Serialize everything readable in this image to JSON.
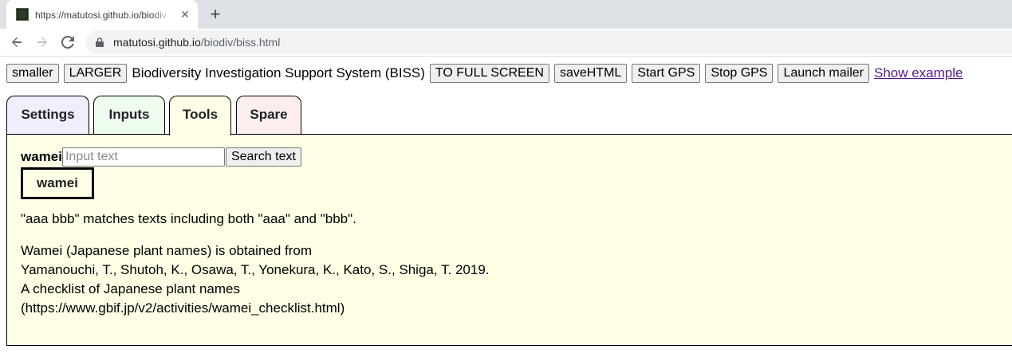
{
  "browser": {
    "tab_title": "https://matutosi.github.io/biodiv",
    "tab_close": "✕",
    "new_tab": "+",
    "url_domain": "matutosi.github.io",
    "url_path": "/biodiv/biss.html"
  },
  "topbar": {
    "smaller_label": "smaller",
    "larger_label": "LARGER",
    "app_title": "Biodiversity Investigation Support System (BISS)",
    "fullscreen_label": "TO FULL SCREEN",
    "savehtml_label": "saveHTML",
    "start_gps_label": "Start GPS",
    "stop_gps_label": "Stop GPS",
    "mailer_label": "Launch mailer",
    "show_example_label": "Show example"
  },
  "tabs": [
    {
      "label": "Settings"
    },
    {
      "label": "Inputs"
    },
    {
      "label": "Tools"
    },
    {
      "label": "Spare"
    }
  ],
  "tools": {
    "search_label": "wamei",
    "search_placeholder": "Input text",
    "search_value": "",
    "search_button": "Search text",
    "result_box": "wamei",
    "hint": "\"aaa bbb\" matches texts including both \"aaa\" and \"bbb\".",
    "source_lines": [
      "Wamei (Japanese plant names) is obtained from",
      "Yamanouchi, T., Shutoh, K., Osawa, T., Yonekura, K., Kato, S., Shiga, T. 2019.",
      "A checklist of Japanese plant names",
      "(https://www.gbif.jp/v2/activities/wamei_checklist.html)"
    ]
  },
  "colors": {
    "tab_settings": "#eeeefc",
    "tab_inputs": "#eefcf0",
    "tab_tools": "#fefee6",
    "tab_spare": "#fdeeee",
    "panel_bg": "#ffffe6",
    "link": "#551a8b"
  },
  "icons": {
    "back": "arrow-left-icon",
    "forward": "arrow-right-icon",
    "reload": "reload-icon",
    "lock": "lock-icon",
    "close": "close-icon",
    "new_tab": "plus-icon"
  }
}
